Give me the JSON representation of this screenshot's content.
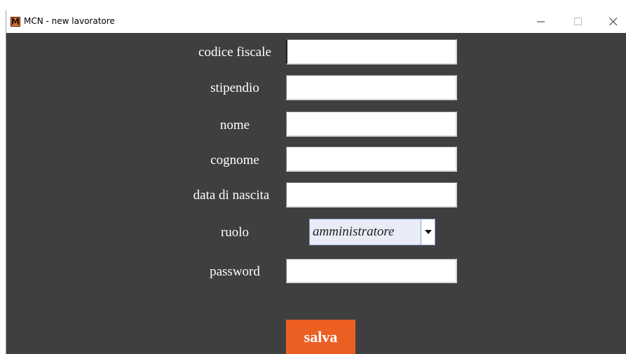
{
  "window": {
    "logo_letter": "M",
    "title": "MCN - new lavoratore"
  },
  "form": {
    "fields": [
      {
        "label": "codice fiscale",
        "value": ""
      },
      {
        "label": "stipendio",
        "value": ""
      },
      {
        "label": "nome",
        "value": ""
      },
      {
        "label": "cognome",
        "value": ""
      },
      {
        "label": "data di nascita",
        "value": ""
      }
    ],
    "role": {
      "label": "ruolo",
      "selected": "amministratore"
    },
    "password": {
      "label": "password",
      "value": ""
    },
    "save_label": "salva"
  },
  "colors": {
    "background": "#3f3f3f",
    "accent": "#ec5f23",
    "logo": "#e8742a"
  },
  "icons": {
    "minimize": "minimize-icon",
    "maximize": "maximize-icon",
    "close": "close-icon",
    "dropdown": "caret-down-icon"
  }
}
